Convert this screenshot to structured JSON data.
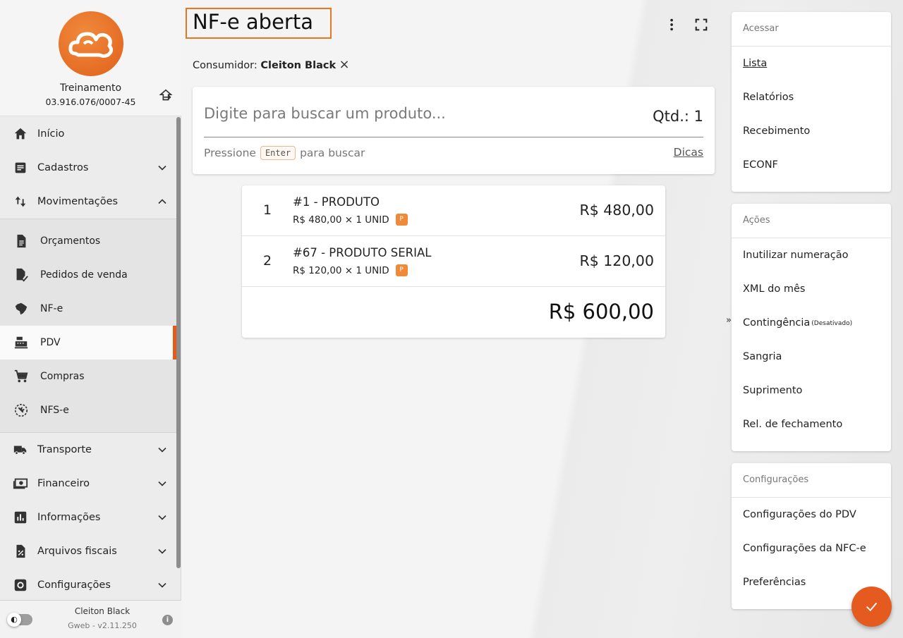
{
  "company": {
    "name": "Treinamento",
    "cnpj": "03.916.076/0007-45"
  },
  "nav": {
    "inicio": "Início",
    "cadastros": "Cadastros",
    "movimentacoes": "Movimentações",
    "orcamentos": "Orçamentos",
    "pedidos": "Pedidos de venda",
    "nfe": "NF-e",
    "pdv": "PDV",
    "compras": "Compras",
    "nfse": "NFS-e",
    "transporte": "Transporte",
    "financeiro": "Financeiro",
    "informacoes": "Informações",
    "arquivos": "Arquivos fiscais",
    "configuracoes": "Configurações"
  },
  "footer": {
    "user": "Cleiton Black",
    "version": "Gweb - v2.11.250"
  },
  "main": {
    "title": "NF-e aberta",
    "consumer_label": "Consumidor:",
    "consumer_name": "Cleiton Black",
    "search_placeholder": "Digite para buscar um produto...",
    "qtd": "Qtd.: 1",
    "hint_pre": "Pressione",
    "hint_key": "Enter",
    "hint_post": "para buscar",
    "dicas": "Dicas"
  },
  "items": [
    {
      "index": "1",
      "name": "#1 - PRODUTO",
      "detail": "R$ 480,00 × 1 UNID",
      "badge": "P",
      "price": "R$ 480,00"
    },
    {
      "index": "2",
      "name": "#67 - PRODUTO SERIAL",
      "detail": "R$ 120,00 × 1 UNID",
      "badge": "P",
      "price": "R$ 120,00"
    }
  ],
  "total": "R$ 600,00",
  "acessar": {
    "header": "Acessar",
    "lista": "Lista",
    "relatorios": "Relatórios",
    "recebimento": "Recebimento",
    "econf": "ECONF"
  },
  "acoes": {
    "header": "Ações",
    "inutilizar": "Inutilizar numeração",
    "xml": "XML do mês",
    "contingencia": "Contingência",
    "contingencia_status": "(Desativado)",
    "sangria": "Sangria",
    "suprimento": "Suprimento",
    "rel_fechamento": "Rel. de fechamento"
  },
  "config": {
    "header": "Configurações",
    "pdv": "Configurações do PDV",
    "nfce": "Configurações da NFC-e",
    "preferencias": "Preferências"
  },
  "colors": {
    "accent": "#e55a1f",
    "badge": "#ef8a3a",
    "title_border": "#e87722"
  },
  "icons": [
    "home-icon",
    "list-icon",
    "swap-icon",
    "document-icon",
    "receipt-check-icon",
    "brazil-map-icon",
    "cash-register-icon",
    "cart-icon",
    "wrench-clock-icon",
    "truck-icon",
    "money-icon",
    "bar-chart-icon",
    "percent-file-icon",
    "gear-icon",
    "logout-icon",
    "kebab-icon",
    "fullscreen-icon",
    "close-icon",
    "check-icon",
    "info-icon"
  ]
}
